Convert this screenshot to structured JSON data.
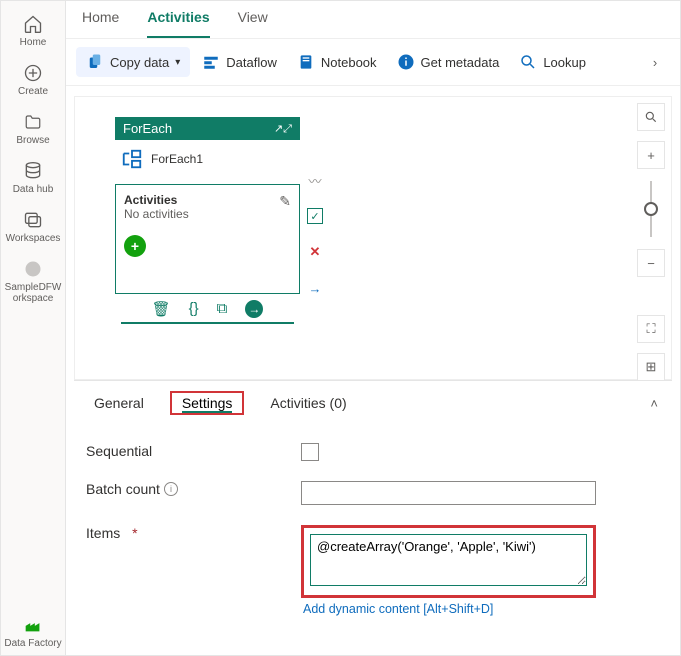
{
  "rail": {
    "home": "Home",
    "create": "Create",
    "browse": "Browse",
    "datahub": "Data hub",
    "workspaces": "Workspaces",
    "sample": "SampleDFW\norkspace",
    "datafactory": "Data Factory"
  },
  "topTabs": {
    "home": "Home",
    "activities": "Activities",
    "view": "View"
  },
  "toolbar": {
    "copy": "Copy data",
    "dataflow": "Dataflow",
    "notebook": "Notebook",
    "getmeta": "Get metadata",
    "lookup": "Lookup"
  },
  "foreach": {
    "title": "ForEach",
    "name": "ForEach1",
    "activities_label": "Activities",
    "no_activities": "No activities"
  },
  "panel": {
    "general": "General",
    "settings": "Settings",
    "activities": "Activities (0)"
  },
  "form": {
    "sequential": "Sequential",
    "batch": "Batch count",
    "items": "Items",
    "items_value": "@createArray('Orange', 'Apple', 'Kiwi')",
    "dynamic": "Add dynamic content [Alt+Shift+D]"
  }
}
